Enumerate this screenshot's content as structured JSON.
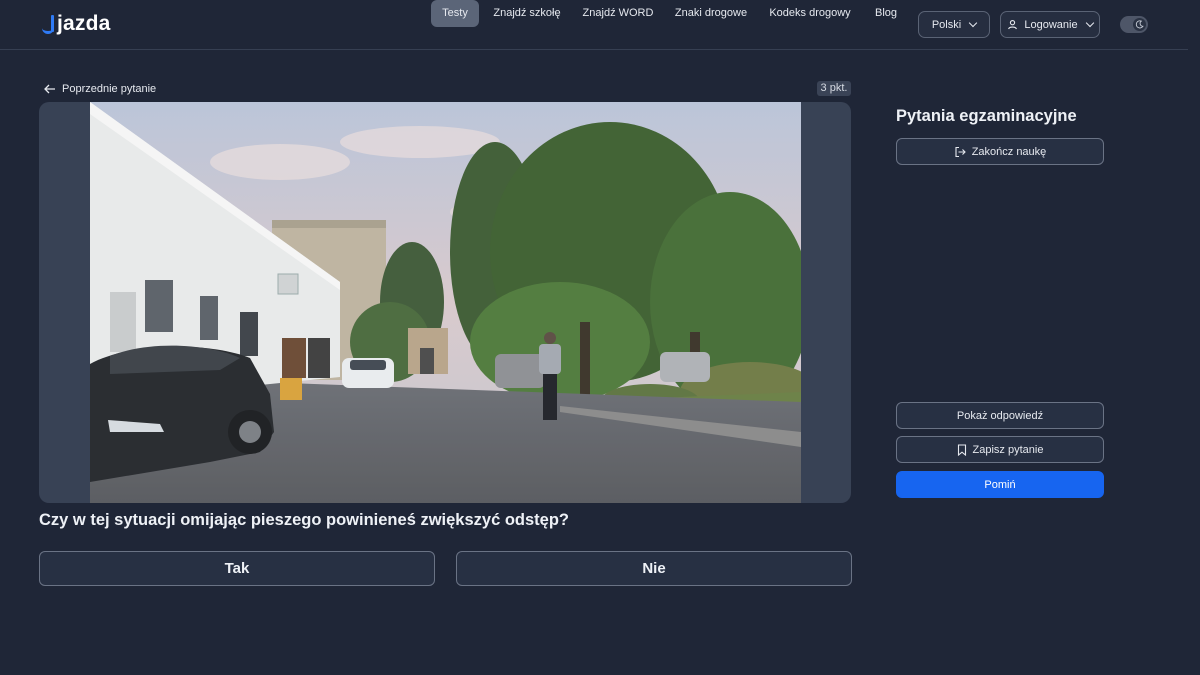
{
  "header": {
    "logo_text": "jazda",
    "nav": [
      {
        "label": "Testy",
        "active": true
      },
      {
        "label": "Znajdź szkołę"
      },
      {
        "label": "Znajdź WORD"
      },
      {
        "label": "Znaki drogowe"
      },
      {
        "label": "Kodeks drogowy"
      },
      {
        "label": "Blog"
      }
    ],
    "language_label": "Polski",
    "login_label": "Logowanie",
    "theme_toggle_icon": "moon-icon"
  },
  "main": {
    "prev_label": "Poprzednie pytanie",
    "points": "3 pkt.",
    "question": "Czy w tej sytuacji omijając pieszego powinieneś zwiększyć odstęp?",
    "answers": [
      "Tak",
      "Nie"
    ]
  },
  "sidebar": {
    "title": "Pytania egzaminacyjne",
    "finish_label": "Zakończ naukę",
    "show_answer_label": "Pokaż odpowiedź",
    "save_label": "Zapisz pytanie",
    "skip_label": "Pomiń"
  },
  "colors": {
    "background": "#1f2637",
    "primary": "#1765f0",
    "logo_accent": "#2f7bf6"
  }
}
